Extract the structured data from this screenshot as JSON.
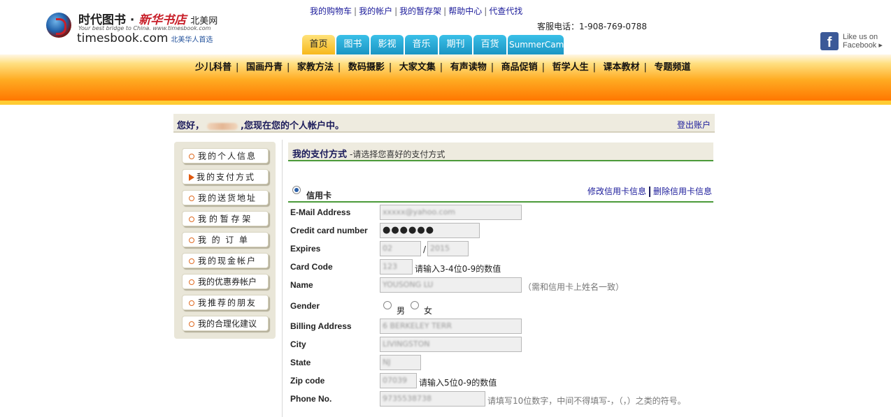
{
  "logo": {
    "cn_name": "时代图书",
    "cn_brand": "新华书店",
    "cn_region": "北美网",
    "tagline": "Your best bridge to China. www.timesbook.com",
    "domain": "timesbook.com",
    "slogan": "北美华人首选"
  },
  "top_links": [
    "我的购物车",
    "我的帐户",
    "我的暂存架",
    "帮助中心",
    "代查代找"
  ],
  "phone": "客服电话：1-908-769-0788",
  "facebook": {
    "line1": "Like us on",
    "line2": "Facebook ▸",
    "glyph": "f"
  },
  "tabs": [
    {
      "label": "首页",
      "active": true
    },
    {
      "label": "图书"
    },
    {
      "label": "影视"
    },
    {
      "label": "音乐"
    },
    {
      "label": "期刊"
    },
    {
      "label": "百货"
    },
    {
      "label": "SummerCamp"
    }
  ],
  "categories": [
    "少儿科普",
    "国画丹青",
    "家教方法",
    "数码摄影",
    "大家文集",
    "有声读物",
    "商品促销",
    "哲学人生",
    "课本教材",
    "专题频道"
  ],
  "welcome": {
    "prefix": "您好，",
    "suffix": ",您现在您的个人帐户中。",
    "logout": "登出账户"
  },
  "sidebar": [
    {
      "label": "我的个人信息",
      "active": false
    },
    {
      "label": "我的支付方式",
      "active": true
    },
    {
      "label": "我的送货地址",
      "active": false
    },
    {
      "label": "我 的 暂 存 架",
      "active": false
    },
    {
      "label": "我  的  订  单",
      "active": false
    },
    {
      "label": "我的现金帐户",
      "active": false
    },
    {
      "label": "我的优惠券帐户",
      "active": false
    },
    {
      "label": "我推荐的朋友",
      "active": false
    },
    {
      "label": "我的合理化建议",
      "active": false
    }
  ],
  "payment": {
    "title": "我的支付方式",
    "subtitle": "-请选择您喜好的支付方式",
    "method": "信用卡",
    "edit_link": "修改信用卡信息",
    "delete_link": "删除信用卡信息"
  },
  "form": {
    "email_label": "E-Mail Address",
    "email_value": "xxxxx@yahoo.com",
    "card_label": "Credit card number",
    "card_value": "●●●●●●",
    "expires_label": "Expires",
    "exp_month": "02",
    "exp_sep": "/",
    "exp_year": "2015",
    "code_label": "Card Code",
    "code_value": "123",
    "code_hint": "请输入3-4位0-9的数值",
    "name_label": "Name",
    "name_value": "YOUSONG LU",
    "name_hint": "（需和信用卡上姓名一致）",
    "gender_label": "Gender",
    "gender_male": "男",
    "gender_female": "女",
    "billing_label": "Billing Address",
    "billing_value": "6 BERKELEY TERR",
    "city_label": "City",
    "city_value": "LIVINGSTON",
    "state_label": "State",
    "state_value": "NJ",
    "zip_label": "Zip code",
    "zip_value": "07039",
    "zip_hint": "请输入5位0-9的数值",
    "phone_label": "Phone No.",
    "phone_value": "9735538738",
    "phone_hint": "请填写10位数字，中间不得填写-，（，）之类的符号。"
  }
}
